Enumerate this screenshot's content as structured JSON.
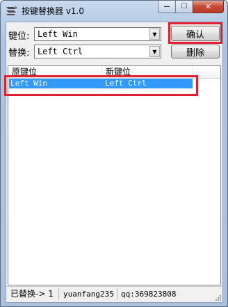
{
  "window": {
    "title": "按键替换器 v1.0",
    "app_icon": "keyboard-swap-icon",
    "controls": {
      "minimize_icon": "minimize-icon",
      "maximize_icon": "maximize-icon",
      "close_icon": "close-icon",
      "minimize_glyph": "—",
      "maximize_glyph": "☐",
      "close_glyph": "✕"
    }
  },
  "form": {
    "key_label": "键位:",
    "key_value": "Left Win",
    "replace_label": "替换:",
    "replace_value": "Left Ctrl",
    "dropdown_glyph": "▼",
    "confirm_button": "确认",
    "delete_button": "删除"
  },
  "list": {
    "columns": [
      "原键位",
      "新键位"
    ],
    "rows": [
      {
        "original": "Left Win",
        "new": "Left Ctrl",
        "selected": true
      }
    ]
  },
  "statusbar": {
    "replaced_count_text": "已替换-> 1",
    "author": "yuanfang235",
    "qq": "qq:369823808"
  },
  "colors": {
    "highlight": "#e0202e",
    "selection": "#3399ff",
    "close_button": "#c7452f"
  }
}
